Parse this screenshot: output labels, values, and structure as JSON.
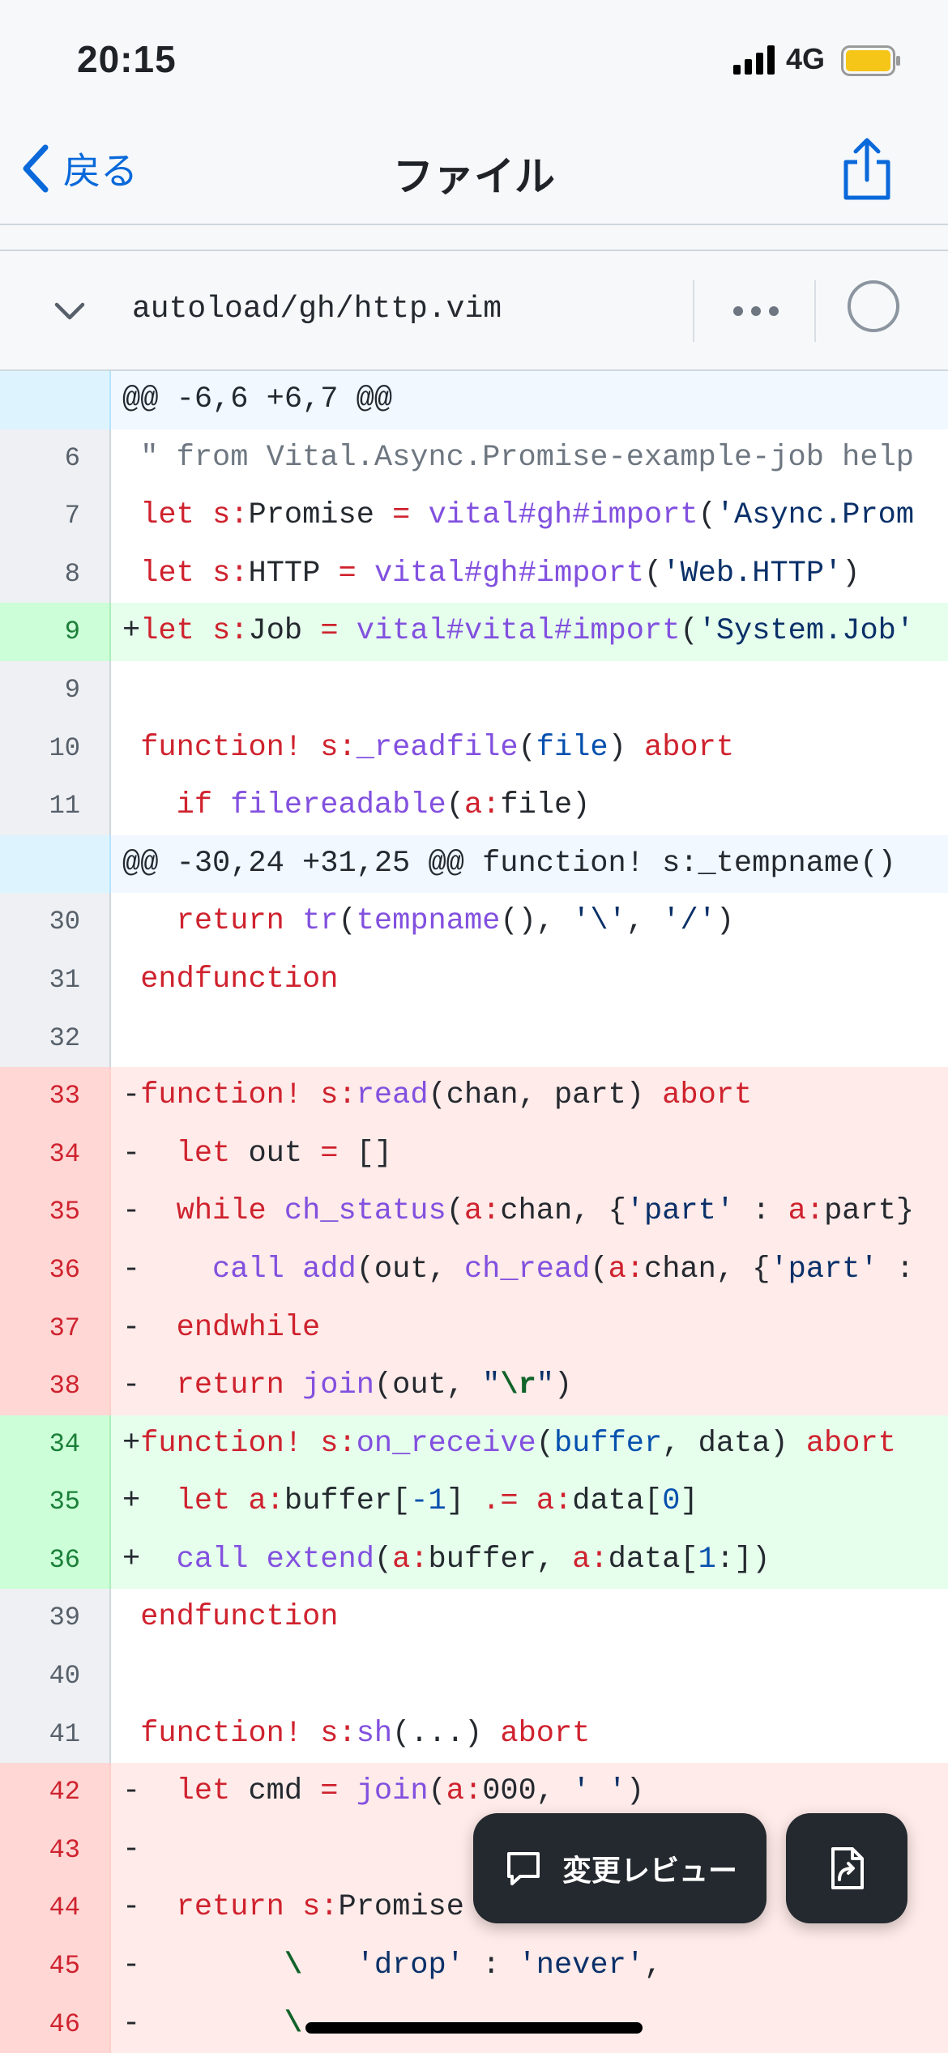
{
  "status_bar": {
    "time": "20:15",
    "network": "4G"
  },
  "nav": {
    "back_label": "戻る",
    "title": "ファイル"
  },
  "file": {
    "path": "autoload/gh/http.vim"
  },
  "floating": {
    "review_label": "変更レビュー"
  },
  "colors": {
    "accent": "#0969da",
    "added_bg": "#e6ffec",
    "deleted_bg": "#ffebe9",
    "hunk_bg": "#f1f8ff",
    "battery": "#f5c518"
  },
  "icons": [
    "back-chevron-icon",
    "share-icon",
    "collapse-chevron-icon",
    "more-icon",
    "viewed-circle-icon",
    "review-comment-icon",
    "file-jump-icon"
  ],
  "diff_lines": [
    {
      "type": "hunk",
      "num": "",
      "tokens": [
        [
          "plain",
          "@@ -6,6 +6,7 @@"
        ]
      ]
    },
    {
      "type": "ctx",
      "num": "6",
      "tokens": [
        [
          "plain",
          " "
        ],
        [
          "com",
          "\" from Vital.Async.Promise-example-job help"
        ]
      ]
    },
    {
      "type": "ctx",
      "num": "7",
      "tokens": [
        [
          "plain",
          " "
        ],
        [
          "kw",
          "let"
        ],
        [
          "plain",
          " "
        ],
        [
          "kw",
          "s:"
        ],
        [
          "plain",
          "Promise "
        ],
        [
          "kw",
          "="
        ],
        [
          "plain",
          " "
        ],
        [
          "fn",
          "vital#gh#import"
        ],
        [
          "plain",
          "("
        ],
        [
          "str",
          "'Async.Prom"
        ]
      ]
    },
    {
      "type": "ctx",
      "num": "8",
      "tokens": [
        [
          "plain",
          " "
        ],
        [
          "kw",
          "let"
        ],
        [
          "plain",
          " "
        ],
        [
          "kw",
          "s:"
        ],
        [
          "plain",
          "HTTP "
        ],
        [
          "kw",
          "="
        ],
        [
          "plain",
          " "
        ],
        [
          "fn",
          "vital#gh#import"
        ],
        [
          "plain",
          "("
        ],
        [
          "str",
          "'Web.HTTP'"
        ],
        [
          "plain",
          ")"
        ]
      ]
    },
    {
      "type": "add",
      "num": "9",
      "tokens": [
        [
          "plain",
          "+"
        ],
        [
          "kw",
          "let"
        ],
        [
          "plain",
          " "
        ],
        [
          "kw",
          "s:"
        ],
        [
          "plain",
          "Job "
        ],
        [
          "kw",
          "="
        ],
        [
          "plain",
          " "
        ],
        [
          "fn",
          "vital#vital#import"
        ],
        [
          "plain",
          "("
        ],
        [
          "str",
          "'System.Job'"
        ]
      ]
    },
    {
      "type": "ctx",
      "num": "9",
      "tokens": [
        [
          "plain",
          " "
        ]
      ]
    },
    {
      "type": "ctx",
      "num": "10",
      "tokens": [
        [
          "plain",
          " "
        ],
        [
          "kw",
          "function!"
        ],
        [
          "plain",
          " "
        ],
        [
          "kw",
          "s:"
        ],
        [
          "fn",
          "_readfile"
        ],
        [
          "plain",
          "("
        ],
        [
          "num",
          "file"
        ],
        [
          "plain",
          ") "
        ],
        [
          "kw",
          "abort"
        ]
      ]
    },
    {
      "type": "ctx",
      "num": "11",
      "tokens": [
        [
          "plain",
          "   "
        ],
        [
          "kw",
          "if"
        ],
        [
          "plain",
          " "
        ],
        [
          "fn",
          "filereadable"
        ],
        [
          "plain",
          "("
        ],
        [
          "kw",
          "a:"
        ],
        [
          "plain",
          "file)"
        ]
      ]
    },
    {
      "type": "hunk",
      "num": "",
      "tokens": [
        [
          "plain",
          "@@ -30,24 +31,25 @@ function! s:_tempname()"
        ]
      ]
    },
    {
      "type": "ctx",
      "num": "30",
      "tokens": [
        [
          "plain",
          "   "
        ],
        [
          "kw",
          "return"
        ],
        [
          "plain",
          " "
        ],
        [
          "fn",
          "tr"
        ],
        [
          "plain",
          "("
        ],
        [
          "fn",
          "tempname"
        ],
        [
          "plain",
          "(), "
        ],
        [
          "str",
          "'\\'"
        ],
        [
          "plain",
          ", "
        ],
        [
          "str",
          "'/'"
        ],
        [
          "plain",
          ")"
        ]
      ]
    },
    {
      "type": "ctx",
      "num": "31",
      "tokens": [
        [
          "plain",
          " "
        ],
        [
          "kw",
          "endfunction"
        ]
      ]
    },
    {
      "type": "ctx",
      "num": "32",
      "tokens": [
        [
          "plain",
          " "
        ]
      ]
    },
    {
      "type": "del",
      "num": "33",
      "tokens": [
        [
          "plain",
          "-"
        ],
        [
          "kw",
          "function!"
        ],
        [
          "plain",
          " "
        ],
        [
          "kw",
          "s:"
        ],
        [
          "fn",
          "read"
        ],
        [
          "plain",
          "(chan, part) "
        ],
        [
          "kw",
          "abort"
        ]
      ]
    },
    {
      "type": "del",
      "num": "34",
      "tokens": [
        [
          "plain",
          "-  "
        ],
        [
          "kw",
          "let"
        ],
        [
          "plain",
          " out "
        ],
        [
          "kw",
          "="
        ],
        [
          "plain",
          " []"
        ]
      ]
    },
    {
      "type": "del",
      "num": "35",
      "tokens": [
        [
          "plain",
          "-  "
        ],
        [
          "kw",
          "while"
        ],
        [
          "plain",
          " "
        ],
        [
          "fn",
          "ch_status"
        ],
        [
          "plain",
          "("
        ],
        [
          "kw",
          "a:"
        ],
        [
          "plain",
          "chan, {"
        ],
        [
          "str",
          "'part'"
        ],
        [
          "plain",
          " : "
        ],
        [
          "kw",
          "a:"
        ],
        [
          "plain",
          "part}"
        ]
      ]
    },
    {
      "type": "del",
      "num": "36",
      "tokens": [
        [
          "plain",
          "-    "
        ],
        [
          "fn",
          "call"
        ],
        [
          "plain",
          " "
        ],
        [
          "fn",
          "add"
        ],
        [
          "plain",
          "(out, "
        ],
        [
          "fn",
          "ch_read"
        ],
        [
          "plain",
          "("
        ],
        [
          "kw",
          "a:"
        ],
        [
          "plain",
          "chan, {"
        ],
        [
          "str",
          "'part'"
        ],
        [
          "plain",
          " :"
        ]
      ]
    },
    {
      "type": "del",
      "num": "37",
      "tokens": [
        [
          "plain",
          "-  "
        ],
        [
          "kw",
          "endwhile"
        ]
      ]
    },
    {
      "type": "del",
      "num": "38",
      "tokens": [
        [
          "plain",
          "-  "
        ],
        [
          "kw",
          "return"
        ],
        [
          "plain",
          " "
        ],
        [
          "fn",
          "join"
        ],
        [
          "plain",
          "(out, "
        ],
        [
          "str",
          "\""
        ],
        [
          "esc",
          "\\r"
        ],
        [
          "str",
          "\""
        ],
        [
          "plain",
          ")"
        ]
      ]
    },
    {
      "type": "add",
      "num": "34",
      "tokens": [
        [
          "plain",
          "+"
        ],
        [
          "kw",
          "function!"
        ],
        [
          "plain",
          " "
        ],
        [
          "kw",
          "s:"
        ],
        [
          "fn",
          "on_receive"
        ],
        [
          "plain",
          "("
        ],
        [
          "num",
          "buffer"
        ],
        [
          "plain",
          ", data) "
        ],
        [
          "kw",
          "abort"
        ]
      ]
    },
    {
      "type": "add",
      "num": "35",
      "tokens": [
        [
          "plain",
          "+  "
        ],
        [
          "kw",
          "let"
        ],
        [
          "plain",
          " "
        ],
        [
          "kw",
          "a:"
        ],
        [
          "plain",
          "buffer["
        ],
        [
          "num",
          "-1"
        ],
        [
          "plain",
          "] "
        ],
        [
          "kw",
          ".="
        ],
        [
          "plain",
          " "
        ],
        [
          "kw",
          "a:"
        ],
        [
          "plain",
          "data["
        ],
        [
          "num",
          "0"
        ],
        [
          "plain",
          "]"
        ]
      ]
    },
    {
      "type": "add",
      "num": "36",
      "tokens": [
        [
          "plain",
          "+  "
        ],
        [
          "fn",
          "call"
        ],
        [
          "plain",
          " "
        ],
        [
          "fn",
          "extend"
        ],
        [
          "plain",
          "("
        ],
        [
          "kw",
          "a:"
        ],
        [
          "plain",
          "buffer, "
        ],
        [
          "kw",
          "a:"
        ],
        [
          "plain",
          "data["
        ],
        [
          "num",
          "1"
        ],
        [
          "plain",
          ":])"
        ]
      ]
    },
    {
      "type": "ctx",
      "num": "39",
      "tokens": [
        [
          "plain",
          " "
        ],
        [
          "kw",
          "endfunction"
        ]
      ]
    },
    {
      "type": "ctx",
      "num": "40",
      "tokens": [
        [
          "plain",
          " "
        ]
      ]
    },
    {
      "type": "ctx",
      "num": "41",
      "tokens": [
        [
          "plain",
          " "
        ],
        [
          "kw",
          "function!"
        ],
        [
          "plain",
          " "
        ],
        [
          "kw",
          "s:"
        ],
        [
          "fn",
          "sh"
        ],
        [
          "plain",
          "(...) "
        ],
        [
          "kw",
          "abort"
        ]
      ]
    },
    {
      "type": "del",
      "num": "42",
      "tokens": [
        [
          "plain",
          "-  "
        ],
        [
          "kw",
          "let"
        ],
        [
          "plain",
          " cmd "
        ],
        [
          "kw",
          "="
        ],
        [
          "plain",
          " "
        ],
        [
          "fn",
          "join"
        ],
        [
          "plain",
          "("
        ],
        [
          "kw",
          "a:"
        ],
        [
          "plain",
          "000, "
        ],
        [
          "str",
          "' '"
        ],
        [
          "plain",
          ")"
        ]
      ]
    },
    {
      "type": "del",
      "num": "43",
      "tokens": [
        [
          "plain",
          "-"
        ]
      ]
    },
    {
      "type": "del",
      "num": "44",
      "tokens": [
        [
          "plain",
          "-  "
        ],
        [
          "kw",
          "return"
        ],
        [
          "plain",
          " "
        ],
        [
          "kw",
          "s:"
        ],
        [
          "plain",
          "Promise"
        ]
      ]
    },
    {
      "type": "del",
      "num": "45",
      "tokens": [
        [
          "plain",
          "-        "
        ],
        [
          "esc",
          "\\"
        ],
        [
          "plain",
          "   "
        ],
        [
          "str",
          "'drop'"
        ],
        [
          "plain",
          " : "
        ],
        [
          "str",
          "'never'"
        ],
        [
          "plain",
          ","
        ]
      ]
    },
    {
      "type": "del",
      "num": "46",
      "tokens": [
        [
          "plain",
          "-        "
        ],
        [
          "esc",
          "\\"
        ]
      ]
    }
  ]
}
